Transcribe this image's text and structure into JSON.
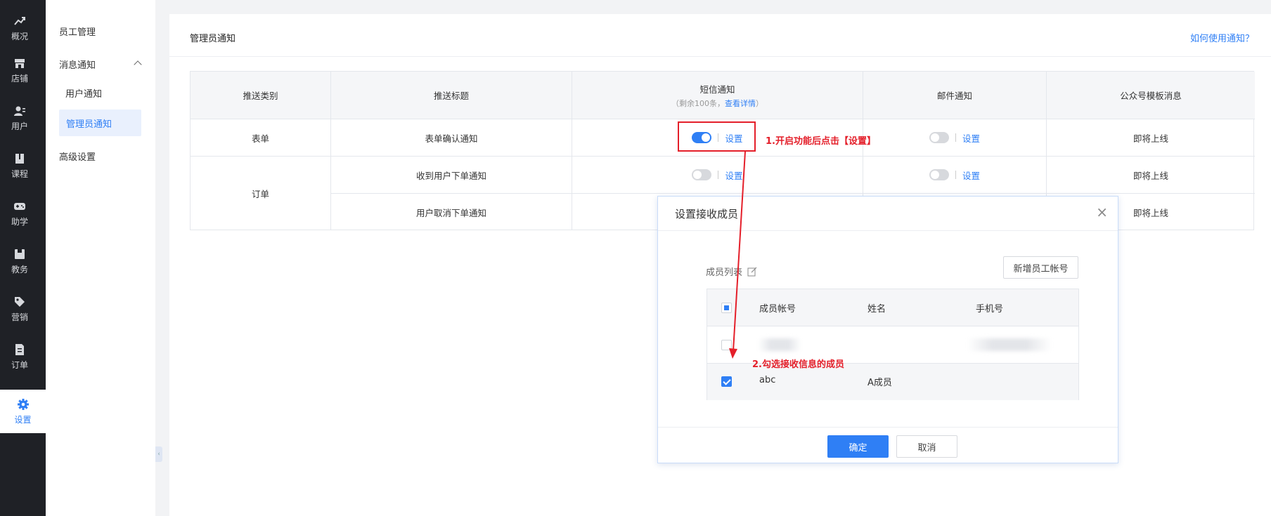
{
  "nav": {
    "items": [
      {
        "label": "概况",
        "icon": "chart-icon"
      },
      {
        "label": "店铺",
        "icon": "store-icon"
      },
      {
        "label": "用户",
        "icon": "user-icon"
      },
      {
        "label": "课程",
        "icon": "book-icon"
      },
      {
        "label": "助学",
        "icon": "gamepad-icon"
      },
      {
        "label": "教务",
        "icon": "box-icon"
      },
      {
        "label": "营销",
        "icon": "tag-icon"
      },
      {
        "label": "订单",
        "icon": "document-icon"
      },
      {
        "label": "设置",
        "icon": "gear-icon"
      }
    ],
    "active_color": "#2f7ff5"
  },
  "submenu": {
    "staff": "员工管理",
    "message": "消息通知",
    "user_notice": "用户通知",
    "admin_notice": "管理员通知",
    "advanced": "高级设置"
  },
  "card": {
    "title": "管理员通知",
    "howto": "如何使用通知？"
  },
  "table": {
    "headers": {
      "type": "推送类别",
      "title": "推送标题",
      "sms": "短信通知",
      "sms_sub_prefix": "（剩余100条，",
      "sms_sub_link": "查看详情",
      "sms_sub_suffix": "）",
      "email": "邮件通知",
      "wechat": "公众号模板消息"
    },
    "cats": {
      "form": "表单",
      "order": "订单"
    },
    "rows": [
      {
        "title": "表单确认通知",
        "sms_on": true,
        "email_on": false,
        "set": "设置",
        "wechat": "即将上线"
      },
      {
        "title": "收到用户下单通知",
        "sms_on": false,
        "email_on": false,
        "set": "设置",
        "wechat": "即将上线"
      },
      {
        "title": "用户取消下单通知",
        "wechat": "即将上线"
      }
    ]
  },
  "annotations": {
    "step1": "1.开启功能后点击【设置】",
    "step2": "2.勾选接收信息的成员",
    "color": "#e41f2a"
  },
  "modal": {
    "title": "设置接收成员",
    "close": "×",
    "member_list": "成员列表",
    "add_button": "新增员工帐号",
    "columns": {
      "account": "成员帐号",
      "name": "姓名",
      "phone": "手机号"
    },
    "rows": [
      {
        "account": "",
        "name": "",
        "phone": "",
        "checked": false
      },
      {
        "account": "abc",
        "name": "A成员",
        "phone": "",
        "checked": true
      }
    ],
    "ok": "确定",
    "cancel": "取消"
  }
}
